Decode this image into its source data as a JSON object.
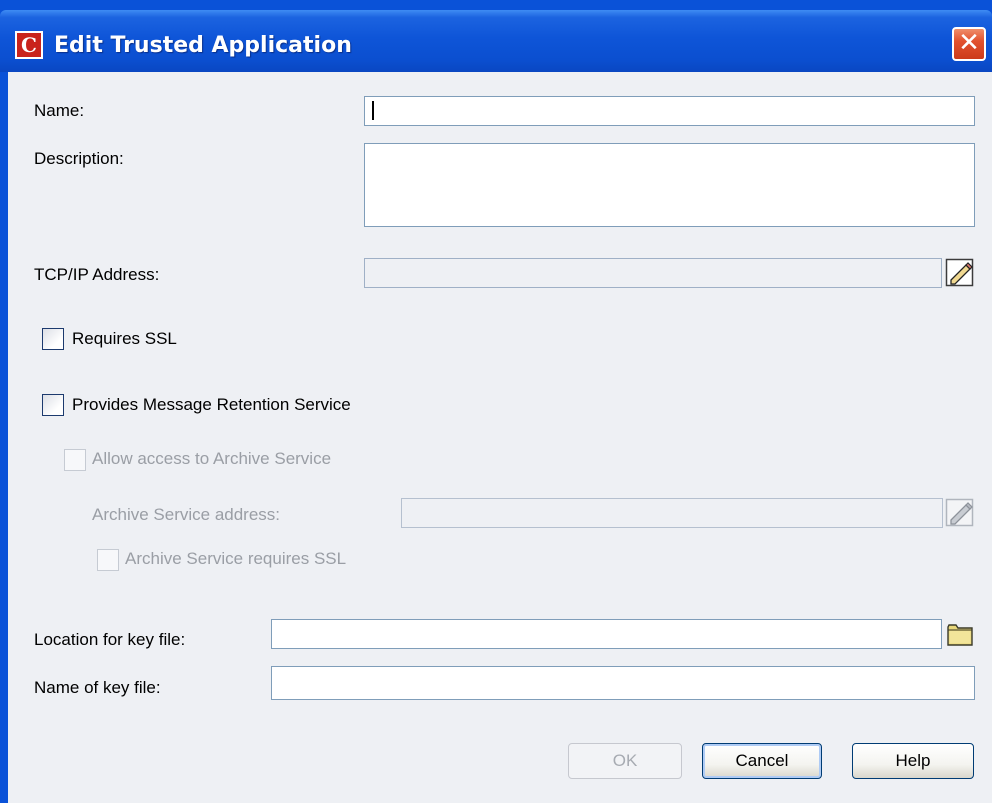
{
  "window": {
    "title": "Edit Trusted Application",
    "app_icon_letter": "C",
    "close_symbol": "✕"
  },
  "form": {
    "name_label": "Name:",
    "name_value": "",
    "description_label": "Description:",
    "description_value": "",
    "tcpip_label": "TCP/IP Address:",
    "tcpip_value": "",
    "requires_ssl_label": "Requires SSL",
    "requires_ssl_checked": false,
    "provides_mrs_label": "Provides Message Retention Service",
    "provides_mrs_checked": false,
    "allow_archive_label": "Allow access to Archive Service",
    "archive_address_label": "Archive Service address:",
    "archive_address_value": "",
    "archive_ssl_label": "Archive Service requires SSL",
    "key_location_label": "Location for key file:",
    "key_location_value": "",
    "key_name_label": "Name of key file:",
    "key_name_value": ""
  },
  "buttons": {
    "ok": "OK",
    "cancel": "Cancel",
    "help": "Help"
  },
  "icons": {
    "edit": "pencil-edit-icon",
    "browse": "folder-icon"
  },
  "colors": {
    "titlebar": "#0a52d8",
    "dialog_bg": "#eef0f4",
    "field_border": "#7f9db9",
    "disabled_text": "#9a9ea5"
  }
}
